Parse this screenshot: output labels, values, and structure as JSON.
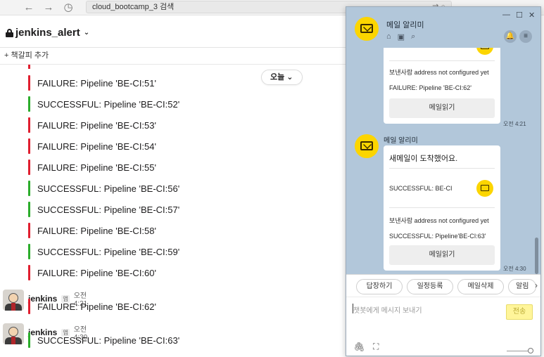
{
  "browser": {
    "back_icon": "←",
    "forward_icon": "→",
    "history_icon": "◷",
    "search_text": "cloud_bootcamp_3 검색",
    "tools": "⇄  ○"
  },
  "channel": {
    "name": "jenkins_alert",
    "chevron": "⌄",
    "add_bookmark": "+  책갈피 추가"
  },
  "date_pill": "오늘 ⌄",
  "pipeline_messages": [
    {
      "status": "failure",
      "text": "FAILURE: Pipeline 'BE-CI:51'"
    },
    {
      "status": "success",
      "text": "SUCCESSFUL: Pipeline 'BE-CI:52'"
    },
    {
      "status": "failure",
      "text": "FAILURE: Pipeline 'BE-CI:53'"
    },
    {
      "status": "failure",
      "text": "FAILURE: Pipeline 'BE-CI:54'"
    },
    {
      "status": "failure",
      "text": "FAILURE: Pipeline 'BE-CI:55'"
    },
    {
      "status": "success",
      "text": "SUCCESSFUL: Pipeline 'BE-CI:56'"
    },
    {
      "status": "success",
      "text": "SUCCESSFUL: Pipeline 'BE-CI:57'"
    },
    {
      "status": "failure",
      "text": "FAILURE: Pipeline 'BE-CI:58'"
    },
    {
      "status": "success",
      "text": "SUCCESSFUL: Pipeline 'BE-CI:59'"
    },
    {
      "status": "failure",
      "text": "FAILURE: Pipeline 'BE-CI:60'"
    }
  ],
  "sender_posts": [
    {
      "name": "jenkins",
      "tag": "앱",
      "time": "오전 4:21",
      "status": "failure",
      "text": "FAILURE: Pipeline 'BE-CI:62'"
    },
    {
      "name": "jenkins",
      "tag": "앱",
      "time": "오전 4:30",
      "status": "success",
      "text": "SUCCESSFUL: Pipeline 'BE-CI:63'"
    }
  ],
  "chat": {
    "title": "메일 알리미",
    "win_minimize": "—",
    "win_maximize": "☐",
    "win_close": "✕",
    "head_icons": [
      "⌂",
      "▣",
      "⌕"
    ],
    "bell_icon": "🔔",
    "menu_icon": "≡",
    "bubble1": {
      "sender_label": "보낸사람  address not configured yet",
      "subject": "FAILURE: Pipeline 'BE-CI:62'",
      "read_button": "메일읽기",
      "time": "오전 4:21"
    },
    "bot_name": "메일 알리미",
    "bubble2": {
      "headline": "새메일이 도착했어요.",
      "preview": "SUCCESSFUL: BE-CI",
      "sender_label": "보낸사람  address not configured yet",
      "subject": "SUCCESSFUL: Pipeline'BE-CI:63'",
      "read_button": "메일읽기",
      "time": "오전 4:30"
    },
    "quick_replies": [
      "답장하기",
      "일정등록",
      "메일삭제",
      "알림"
    ],
    "quick_arrow": "›",
    "input_placeholder": "챗봇에게 메시지 보내기",
    "send_label": "전송",
    "attach_icon": "🖇",
    "capture_icon": "⛶"
  }
}
